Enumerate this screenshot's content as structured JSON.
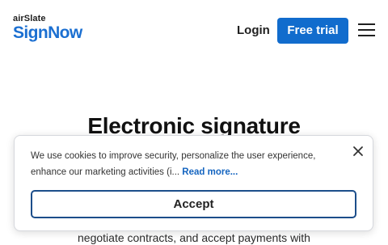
{
  "header": {
    "logo_top": "airSlate",
    "logo_main": "SignNow",
    "login_label": "Login",
    "free_trial_label": "Free trial",
    "menu_icon": "hamburger-menu-icon"
  },
  "hero": {
    "title": "Electronic signature",
    "body_line": "negotiate contracts, and accept payments with"
  },
  "cookie_banner": {
    "text": "We use cookies to improve security, personalize the user experience, enhance our marketing activities (i...",
    "read_more": "Read more...",
    "accept_label": "Accept",
    "close_icon": "close-icon"
  },
  "colors": {
    "brand_blue": "#1b6fd1",
    "button_blue": "#116ccd",
    "accept_border": "#1c4e8a",
    "link_blue": "#1565c0"
  }
}
